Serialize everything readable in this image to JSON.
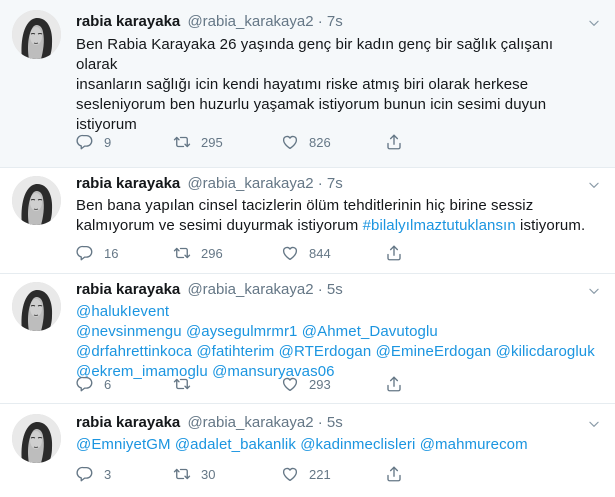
{
  "tweets": [
    {
      "name": "rabia karayaka",
      "handle": "@rabia_karakaya2",
      "dot": "·",
      "time": "7s",
      "text": "Ben Rabia Karayaka 26 yaşında genç bir kadın genç bir sağlık çalışanı olarak insanların sağlığı icin kendi hayatımı riske atmış biri olarak herkese sesleniyorum ben huzurlu yaşamak istiyorum bunun icin sesimi duyun istiyorum",
      "lines": [
        "Ben Rabia Karayaka 26 yaşında genç bir kadın genç bir sağlık çalışanı olarak",
        "insanların sağlığı icin kendi hayatımı riske atmış biri olarak herkese",
        "sesleniyorum ben huzurlu yaşamak istiyorum bunun icin sesimi duyun",
        "istiyorum"
      ],
      "replies": "9",
      "retweets": "295",
      "likes": "826"
    },
    {
      "name": "rabia karayaka",
      "handle": "@rabia_karakaya2",
      "dot": "·",
      "time": "7s",
      "lines": [
        "Ben bana yapılan cinsel tacizlerin ölüm tehditlerinin hiç birine sessiz",
        "kalmıyorum ve sesimi duyurmak istiyorum "
      ],
      "hashtag": "#bilalyılmaztutuklansın",
      "suffix": " istiyorum.",
      "replies": "16",
      "retweets": "296",
      "likes": "844"
    },
    {
      "name": "rabia karayaka",
      "handle": "@rabia_karakaya2",
      "dot": "·",
      "time": "5s",
      "mention_lines": [
        [
          "@halukIevent"
        ],
        [
          "@nevsinmengu",
          "@aysegulmrmr1",
          "@Ahmet_Davutoglu"
        ],
        [
          "@drfahrettinkoca",
          "@fatihterim",
          "@RTErdogan",
          "@EmineErdogan",
          "@kilicdarogluk"
        ],
        [
          "@ekrem_imamoglu",
          "@mansuryavas06"
        ]
      ],
      "replies": "6",
      "retweets": "",
      "likes": "293"
    },
    {
      "name": "rabia karayaka",
      "handle": "@rabia_karakaya2",
      "dot": "·",
      "time": "5s",
      "mention_lines": [
        [
          "@EmniyetGM",
          "@adalet_bakanlik",
          "@kadinmeclisleri",
          "@mahmurecom"
        ]
      ],
      "replies": "3",
      "retweets": "30",
      "likes": "221"
    }
  ],
  "colors": {
    "link": "#1b95e0",
    "secondary": "#657786",
    "divider": "#e6ecf0"
  },
  "icons": {
    "reply": "reply-icon",
    "retweet": "retweet-icon",
    "like": "heart-icon",
    "share": "share-icon",
    "more": "chevron-down-icon"
  }
}
